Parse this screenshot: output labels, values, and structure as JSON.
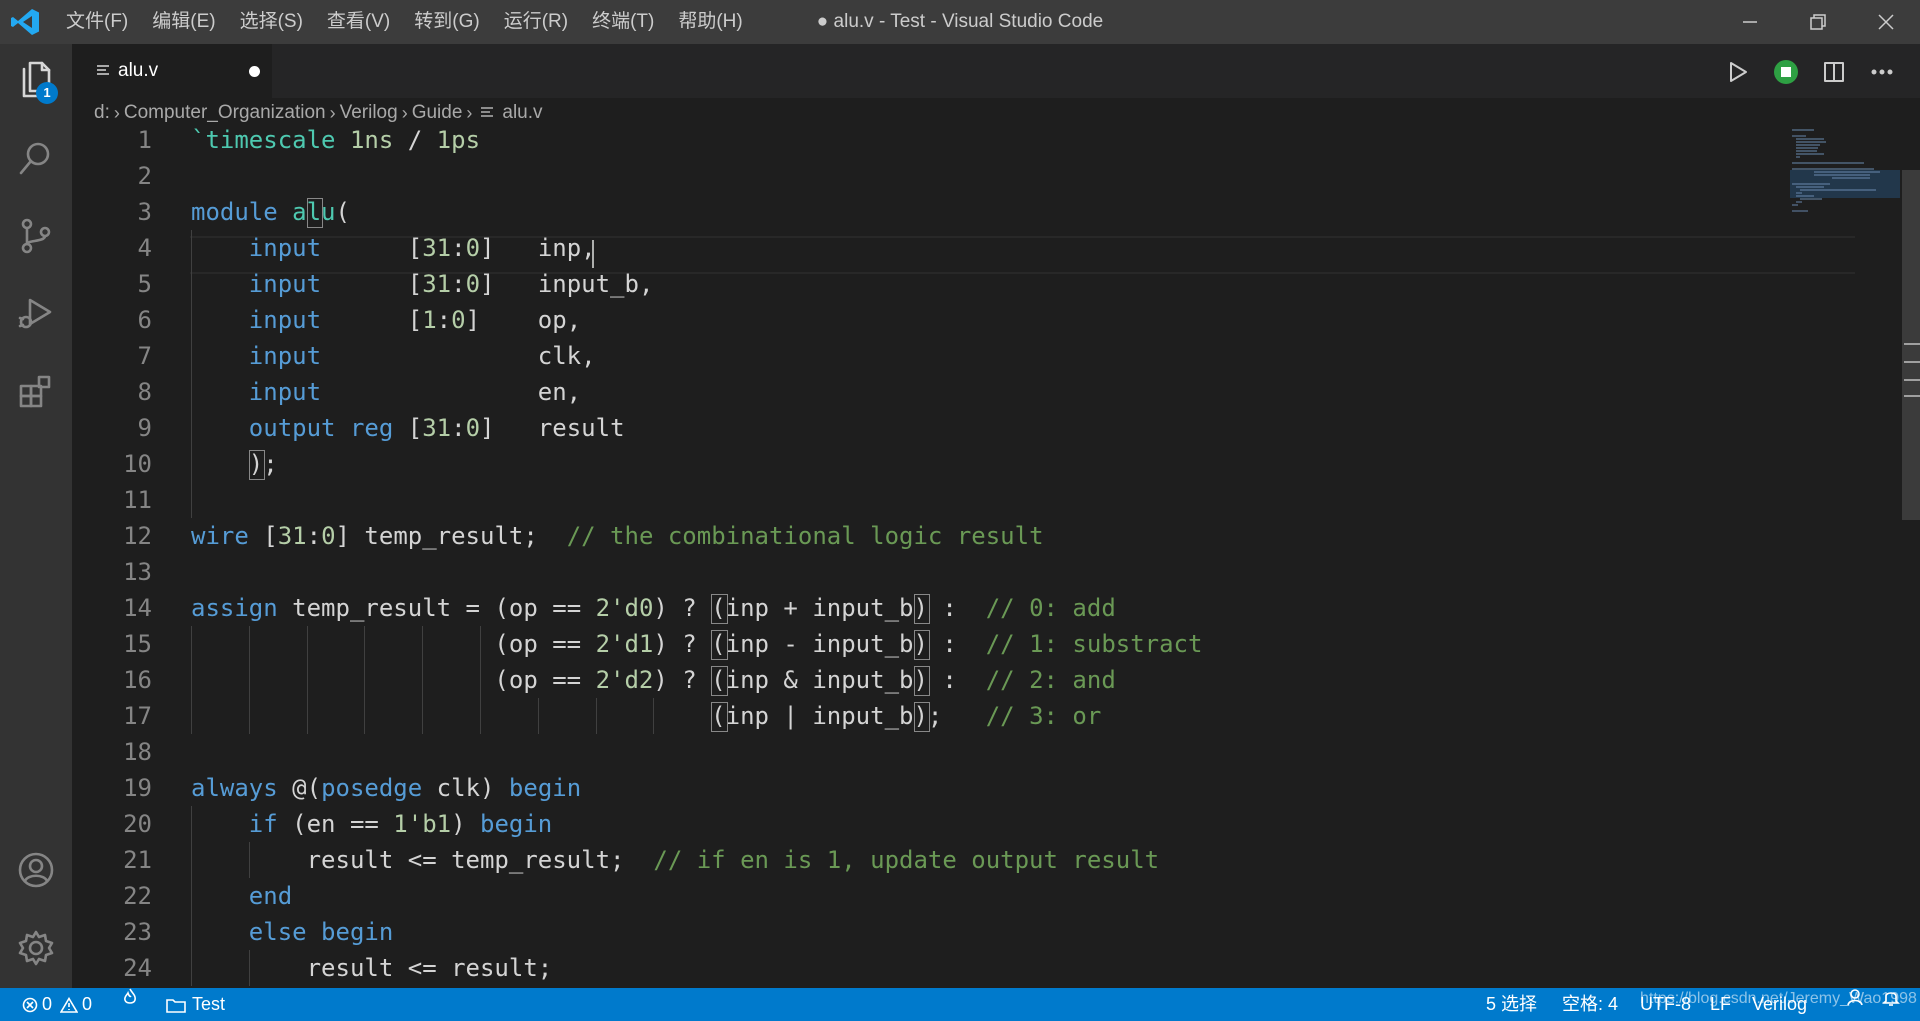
{
  "window": {
    "title": "● alu.v - Test - Visual Studio Code",
    "menu": [
      "文件(F)",
      "编辑(E)",
      "选择(S)",
      "查看(V)",
      "转到(G)",
      "运行(R)",
      "终端(T)",
      "帮助(H)"
    ]
  },
  "activity_bar": {
    "explorer_badge": "1",
    "items": [
      "explorer-icon",
      "search-icon",
      "source-control-icon",
      "run-debug-icon",
      "extensions-icon"
    ],
    "bottom_items": [
      "accounts-icon",
      "manage-gear-icon"
    ]
  },
  "tabs": [
    {
      "label": "alu.v",
      "dirty": true,
      "active": true
    }
  ],
  "breadcrumb": [
    "d:",
    "Computer_Organization",
    "Verilog",
    "Guide",
    "alu.v"
  ],
  "editor": {
    "language": "verilog",
    "cursor": {
      "line": 4,
      "after_text": "inp"
    },
    "lines": [
      {
        "n": "1",
        "tokens": [
          {
            "t": "`timescale",
            "c": "ty"
          },
          {
            "t": " "
          },
          {
            "t": "1ns",
            "c": "num"
          },
          {
            "t": " / "
          },
          {
            "t": "1ps",
            "c": "num"
          }
        ]
      },
      {
        "n": "2",
        "tokens": []
      },
      {
        "n": "3",
        "tokens": [
          {
            "t": "module",
            "c": "kw"
          },
          {
            "t": " "
          },
          {
            "t": "alu",
            "c": "fn"
          },
          {
            "t": "("
          }
        ]
      },
      {
        "n": "4",
        "tokens": [
          {
            "t": "    "
          },
          {
            "t": "input",
            "c": "kw"
          },
          {
            "t": "      ["
          },
          {
            "t": "31",
            "c": "num"
          },
          {
            "t": ":"
          },
          {
            "t": "0",
            "c": "num"
          },
          {
            "t": "]   inp,"
          }
        ]
      },
      {
        "n": "5",
        "tokens": [
          {
            "t": "    "
          },
          {
            "t": "input",
            "c": "kw"
          },
          {
            "t": "      ["
          },
          {
            "t": "31",
            "c": "num"
          },
          {
            "t": ":"
          },
          {
            "t": "0",
            "c": "num"
          },
          {
            "t": "]   input_b,"
          }
        ]
      },
      {
        "n": "6",
        "tokens": [
          {
            "t": "    "
          },
          {
            "t": "input",
            "c": "kw"
          },
          {
            "t": "      ["
          },
          {
            "t": "1",
            "c": "num"
          },
          {
            "t": ":"
          },
          {
            "t": "0",
            "c": "num"
          },
          {
            "t": "]    op,"
          }
        ]
      },
      {
        "n": "7",
        "tokens": [
          {
            "t": "    "
          },
          {
            "t": "input",
            "c": "kw"
          },
          {
            "t": "               clk,"
          }
        ]
      },
      {
        "n": "8",
        "tokens": [
          {
            "t": "    "
          },
          {
            "t": "input",
            "c": "kw"
          },
          {
            "t": "               en,"
          }
        ]
      },
      {
        "n": "9",
        "tokens": [
          {
            "t": "    "
          },
          {
            "t": "output",
            "c": "kw"
          },
          {
            "t": " "
          },
          {
            "t": "reg",
            "c": "kw"
          },
          {
            "t": " ["
          },
          {
            "t": "31",
            "c": "num"
          },
          {
            "t": ":"
          },
          {
            "t": "0",
            "c": "num"
          },
          {
            "t": "]   result"
          }
        ]
      },
      {
        "n": "10",
        "tokens": [
          {
            "t": "    );"
          }
        ]
      },
      {
        "n": "11",
        "tokens": []
      },
      {
        "n": "12",
        "tokens": [
          {
            "t": "wire",
            "c": "kw"
          },
          {
            "t": " ["
          },
          {
            "t": "31",
            "c": "num"
          },
          {
            "t": ":"
          },
          {
            "t": "0",
            "c": "num"
          },
          {
            "t": "] temp_result;  "
          },
          {
            "t": "// the combinational logic result",
            "c": "cm"
          }
        ]
      },
      {
        "n": "13",
        "tokens": []
      },
      {
        "n": "14",
        "tokens": [
          {
            "t": "assign",
            "c": "kw"
          },
          {
            "t": " temp_result = (op == "
          },
          {
            "t": "2'd0",
            "c": "num"
          },
          {
            "t": ") ? (inp + input_b) :  "
          },
          {
            "t": "// 0: add",
            "c": "cm"
          }
        ]
      },
      {
        "n": "15",
        "tokens": [
          {
            "t": "                     (op == "
          },
          {
            "t": "2'd1",
            "c": "num"
          },
          {
            "t": ") ? (inp - input_b) :  "
          },
          {
            "t": "// 1: substract",
            "c": "cm"
          }
        ]
      },
      {
        "n": "16",
        "tokens": [
          {
            "t": "                     (op == "
          },
          {
            "t": "2'd2",
            "c": "num"
          },
          {
            "t": ") ? (inp & input_b) :  "
          },
          {
            "t": "// 2: and",
            "c": "cm"
          }
        ]
      },
      {
        "n": "17",
        "tokens": [
          {
            "t": "                                    (inp | input_b);   "
          },
          {
            "t": "// 3: or",
            "c": "cm"
          }
        ]
      },
      {
        "n": "18",
        "tokens": []
      },
      {
        "n": "19",
        "tokens": [
          {
            "t": "always",
            "c": "kw"
          },
          {
            "t": " @("
          },
          {
            "t": "posedge",
            "c": "kw"
          },
          {
            "t": " clk) "
          },
          {
            "t": "begin",
            "c": "kw"
          }
        ]
      },
      {
        "n": "20",
        "tokens": [
          {
            "t": "    "
          },
          {
            "t": "if",
            "c": "kw"
          },
          {
            "t": " (en == "
          },
          {
            "t": "1'b1",
            "c": "num"
          },
          {
            "t": ") "
          },
          {
            "t": "begin",
            "c": "kw"
          }
        ]
      },
      {
        "n": "21",
        "tokens": [
          {
            "t": "        result <= temp_result;  "
          },
          {
            "t": "// if en is 1, update output result",
            "c": "cm"
          }
        ]
      },
      {
        "n": "22",
        "tokens": [
          {
            "t": "    "
          },
          {
            "t": "end",
            "c": "kw"
          }
        ]
      },
      {
        "n": "23",
        "tokens": [
          {
            "t": "    "
          },
          {
            "t": "else",
            "c": "kw"
          },
          {
            "t": " "
          },
          {
            "t": "begin",
            "c": "kw"
          }
        ]
      },
      {
        "n": "24",
        "tokens": [
          {
            "t": "        result <= result;"
          }
        ]
      }
    ]
  },
  "status_bar": {
    "errors": "0",
    "warnings": "0",
    "folder": "Test",
    "selections": "5 选择",
    "spaces": "空格: 4",
    "encoding": "UTF-8",
    "eol": "LF",
    "language": "Verilog",
    "watermark": "https://blog.csdn.net/Jeremy_Wao1998"
  },
  "colors": {
    "keyword": "#569cd6",
    "type": "#4ec9b0",
    "number": "#b5cea8",
    "comment": "#6a9955",
    "status_bar": "#007acc",
    "run_extension": "#2ea043"
  }
}
